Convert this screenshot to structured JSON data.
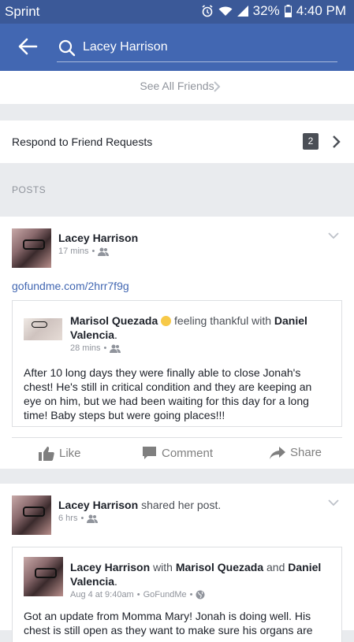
{
  "status": {
    "carrier": "Sprint",
    "battery": "32%",
    "time": "4:40 PM"
  },
  "search": {
    "query": "Lacey Harrison"
  },
  "friends": {
    "see_all": "See All Friends"
  },
  "requests": {
    "label": "Respond to Friend Requests",
    "count": "2"
  },
  "posts": {
    "header": "POSTS",
    "items": [
      {
        "author": "Lacey Harrison",
        "time": "17 mins",
        "link": "gofundme.com/2hrr7f9g",
        "shared": {
          "author": "Marisol Quezada",
          "feeling": "feeling thankful with",
          "with_first": "Daniel",
          "with_second": "Valencia",
          "time": "28 mins",
          "text": "After 10 long days they were finally able to close Jonah's chest! He's still in critical condition and they are keeping an eye on him, but we had been waiting for this day for a long time! Baby steps but were going places!!!"
        },
        "actions": {
          "like": "Like",
          "comment": "Comment",
          "share": "Share"
        }
      },
      {
        "author": "Lacey Harrison",
        "shared_label": "shared her post.",
        "time": "6 hrs",
        "shared": {
          "author": "Lacey Harrison",
          "with_word": "with",
          "tag1": "Marisol Quezada",
          "and_word": "and",
          "tag2_first": "Daniel",
          "tag2_second": "Valencia",
          "time": "Aug 4 at 9:40am",
          "via": "GoFundMe",
          "text_line1": "Got an update from Momma Mary! Jonah is doing well. His",
          "text_line2": "chest is still open as they want to make sure his organs are"
        }
      }
    ]
  }
}
